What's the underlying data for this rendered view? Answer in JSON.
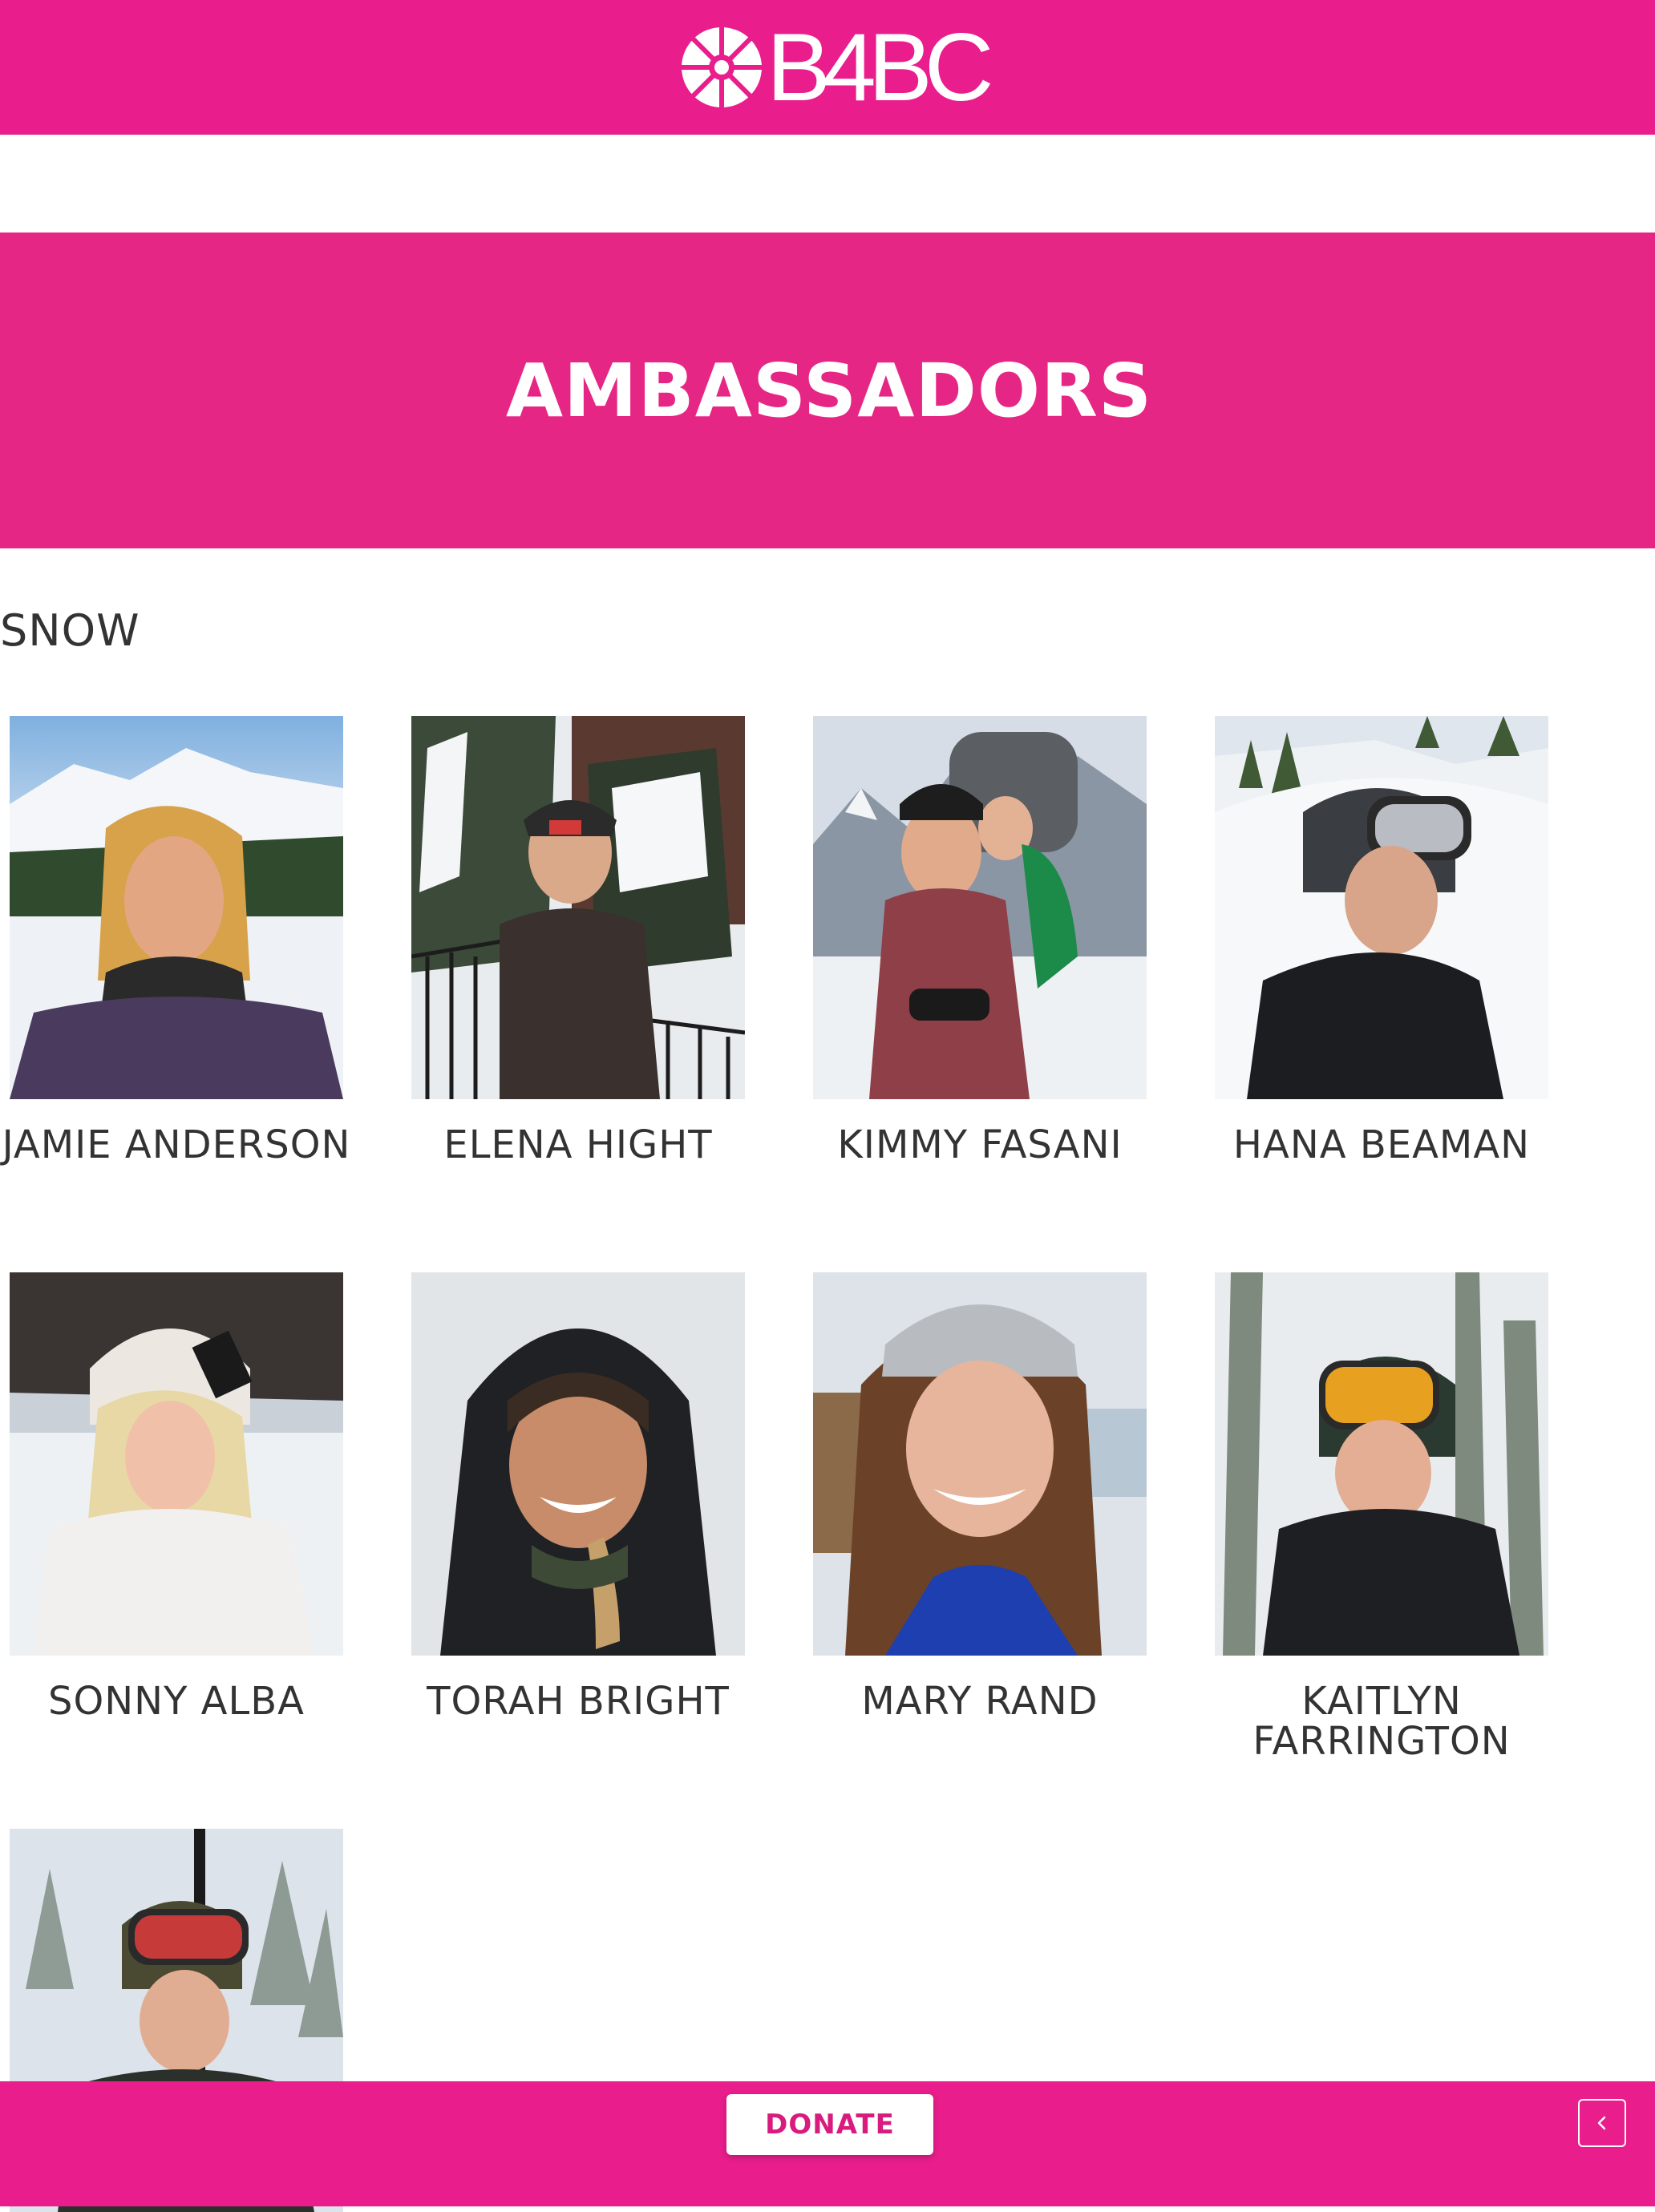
{
  "header": {
    "logo_text": "B4BC",
    "colors": {
      "brand": "#e91e8c",
      "hero": "#e62684"
    }
  },
  "hero": {
    "title": "AMBASSADORS"
  },
  "section": {
    "title": "SNOW"
  },
  "ambassadors": [
    {
      "name": "JAMIE ANDERSON"
    },
    {
      "name": "ELENA HIGHT"
    },
    {
      "name": "KIMMY FASANI"
    },
    {
      "name": "HANA BEAMAN"
    },
    {
      "name": "SONNY ALBA"
    },
    {
      "name": "TORAH BRIGHT"
    },
    {
      "name": "MARY RAND"
    },
    {
      "name": "KAITLYN FARRINGTON"
    },
    {
      "name": ""
    }
  ],
  "footer": {
    "donate_label": "DONATE",
    "back_icon": "chevron-left-icon"
  }
}
